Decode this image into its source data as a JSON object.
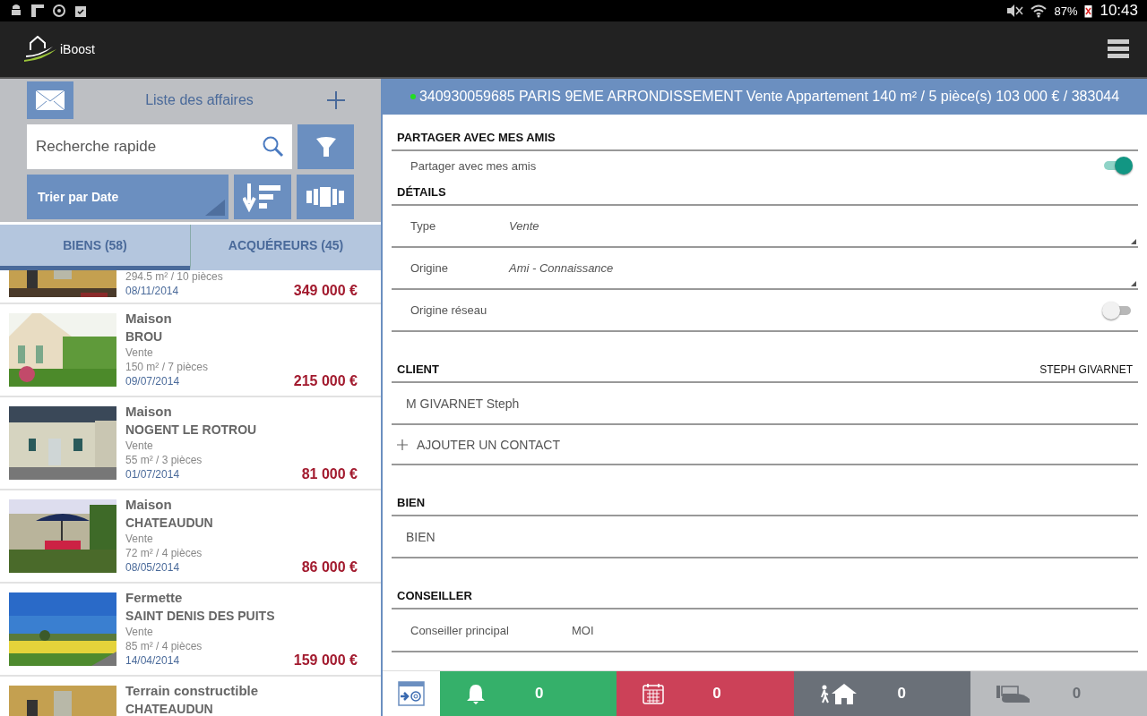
{
  "status_bar": {
    "battery": "87%",
    "time": "10:43"
  },
  "app_bar": {
    "title": "iBoost"
  },
  "list_panel": {
    "title": "Liste des affaires",
    "search": {
      "placeholder": "Recherche rapide"
    },
    "sort": {
      "label": "Trier par Date"
    },
    "tabs": [
      {
        "label": "BIENS (58)",
        "selected": true
      },
      {
        "label": "ACQUÉREURS (45)",
        "selected": false
      }
    ],
    "items": [
      {
        "surface": "294.5 m² / 10 pièces",
        "date": "08/11/2014",
        "price": "349 000 €"
      },
      {
        "type": "Maison",
        "city": "BROU",
        "transaction": "Vente",
        "surface": "150 m² / 7 pièces",
        "date": "09/07/2014",
        "price": "215 000 €"
      },
      {
        "type": "Maison",
        "city": "NOGENT LE ROTROU",
        "transaction": "Vente",
        "surface": "55 m² / 3 pièces",
        "date": "01/07/2014",
        "price": "81 000 €"
      },
      {
        "type": "Maison",
        "city": "CHATEAUDUN",
        "transaction": "Vente",
        "surface": "72 m² / 4 pièces",
        "date": "08/05/2014",
        "price": "86 000 €"
      },
      {
        "type": "Fermette",
        "city": "SAINT DENIS DES PUITS",
        "transaction": "Vente",
        "surface": "85 m² / 4 pièces",
        "date": "14/04/2014",
        "price": "159 000 €"
      },
      {
        "type": "Terrain constructible",
        "city": "CHATEAUDUN"
      }
    ]
  },
  "detail": {
    "header": {
      "text": "340930059685 PARIS 9EME ARRONDISSEMENT Vente Appartement 140 m² / 5 pièce(s) 103 000 € / 383044",
      "color": "#22dd22"
    },
    "sections": [
      {
        "heading": "PARTAGER AVEC MES AMIS",
        "rows": [
          {
            "kind": "toggle",
            "label": "Partager avec mes amis",
            "on": true
          }
        ]
      },
      {
        "heading": "DÉTAILS",
        "rows": [
          {
            "kind": "select",
            "label": "Type",
            "value": "Vente"
          },
          {
            "kind": "select",
            "label": "Origine",
            "value": "Ami - Connaissance"
          },
          {
            "kind": "toggle",
            "label": "Origine réseau",
            "on": false
          }
        ]
      },
      {
        "heading": "CLIENT",
        "heading_value": "STEPH GIVARNET",
        "rows": [
          {
            "kind": "text",
            "text": "M GIVARNET Steph"
          },
          {
            "kind": "add",
            "text": "AJOUTER UN CONTACT"
          }
        ]
      },
      {
        "heading": "BIEN",
        "rows": [
          {
            "kind": "text",
            "text": "BIEN"
          }
        ]
      },
      {
        "heading": "CONSEILLER",
        "rows": [
          {
            "kind": "field",
            "label": "Conseiller principal",
            "value": "MOI"
          }
        ]
      }
    ]
  },
  "bottom_bar": {
    "counters": [
      {
        "kind": "alerts",
        "count": "0",
        "color": "#35b06a"
      },
      {
        "kind": "calendar",
        "count": "0",
        "color": "#cc4158"
      },
      {
        "kind": "visits",
        "count": "0",
        "color": "#6a7078"
      },
      {
        "kind": "offers",
        "count": "0",
        "color": "#b9bbbe"
      }
    ]
  }
}
